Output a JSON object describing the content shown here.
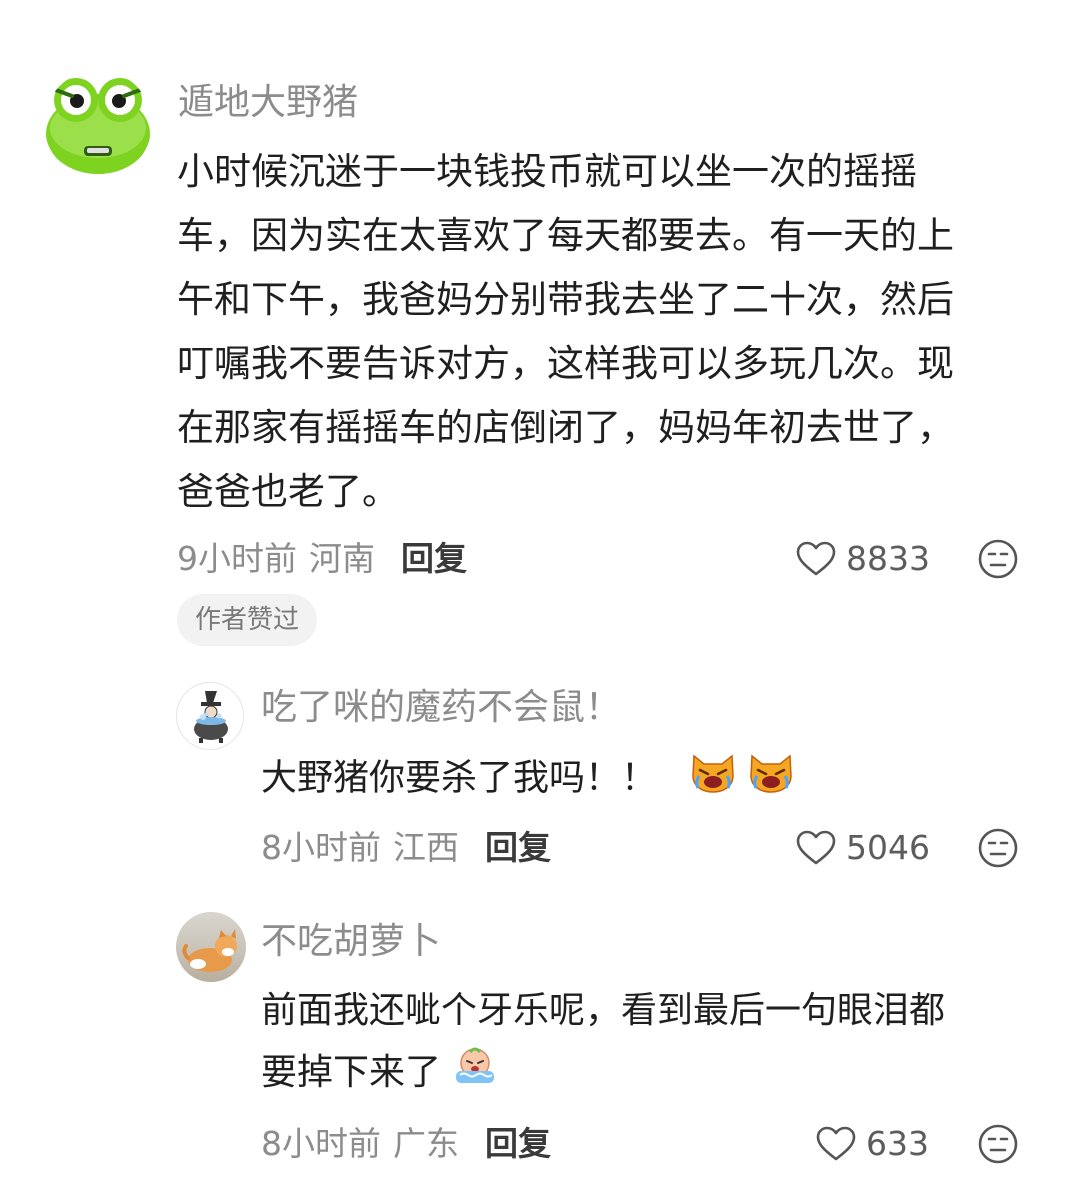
{
  "comments": [
    {
      "username": "遁地大野猪",
      "lines": [
        "小时候沉迷于一块钱投币就可以坐一次的摇摇",
        "车，因为实在太喜欢了每天都要去。有一天的上",
        "午和下午，我爸妈分别带我去坐了二十次，然后",
        "叮嘱我不要告诉对方，这样我可以多玩几次。现",
        "在那家有摇摇车的店倒闭了，妈妈年初去世了，",
        "爸爸也老了。"
      ],
      "time": "9小时前",
      "location": "河南",
      "reply_label": "回复",
      "likes": "8833",
      "author_badge": "作者赞过",
      "avatar_icon": "green-frog-avatar"
    },
    {
      "username": "吃了咪的魔药不会鼠！",
      "lines": [
        "大野猪你要杀了我吗！！"
      ],
      "emojis": [
        "crying-cat-emoji",
        "crying-cat-emoji"
      ],
      "time": "8小时前",
      "location": "江西",
      "reply_label": "回复",
      "likes": "5046",
      "avatar_icon": "witch-cauldron-avatar"
    },
    {
      "username": "不吃胡萝卜",
      "lines": [
        "前面我还呲个牙乐呢，看到最后一句眼泪都",
        "要掉下来了"
      ],
      "emojis": [
        "crying-face-emoji"
      ],
      "time": "8小时前",
      "location": "广东",
      "reply_label": "回复",
      "likes": "633",
      "avatar_icon": "cat-photo-avatar"
    }
  ],
  "colors": {
    "username": "#8c8c8c",
    "content": "#1f1f1f",
    "badge_bg": "#f2f2f2",
    "frog_green": "#7ed321"
  }
}
